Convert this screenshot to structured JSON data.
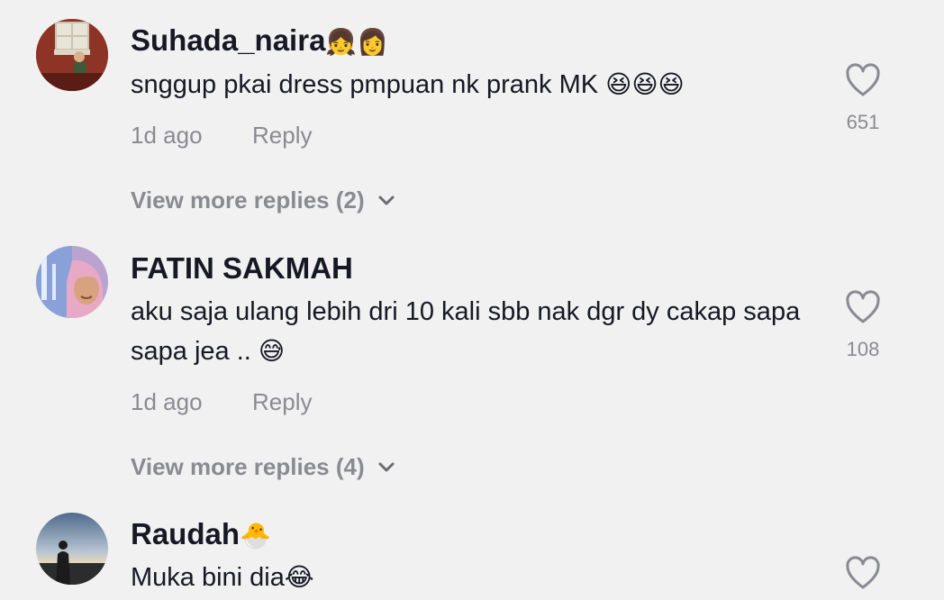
{
  "comments": [
    {
      "username": "Suhada_naira",
      "username_emoji": "👧👩",
      "text": "snggup pkai dress pmpuan nk prank MK",
      "text_emoji": "😆😆😆",
      "time": "1d ago",
      "reply_label": "Reply",
      "likes": "651",
      "view_more": "View more replies (2)",
      "avatar_icon": "photo-avatar"
    },
    {
      "username": "FATIN SAKMAH",
      "username_emoji": "",
      "text": "aku saja ulang lebih dri 10 kali sbb nak dgr dy cakap sapa sapa jea ..",
      "text_emoji": "😅",
      "time": "1d ago",
      "reply_label": "Reply",
      "likes": "108",
      "view_more": "View more replies (4)",
      "avatar_icon": "photo-avatar"
    },
    {
      "username": "Raudah",
      "username_emoji": "🐣",
      "text": "Muka bini dia",
      "text_emoji": "😂",
      "avatar_icon": "photo-avatar"
    }
  ],
  "colors": {
    "background": "#f1f1f2",
    "primary_text": "#161823",
    "secondary_text": "#8a8b91"
  }
}
